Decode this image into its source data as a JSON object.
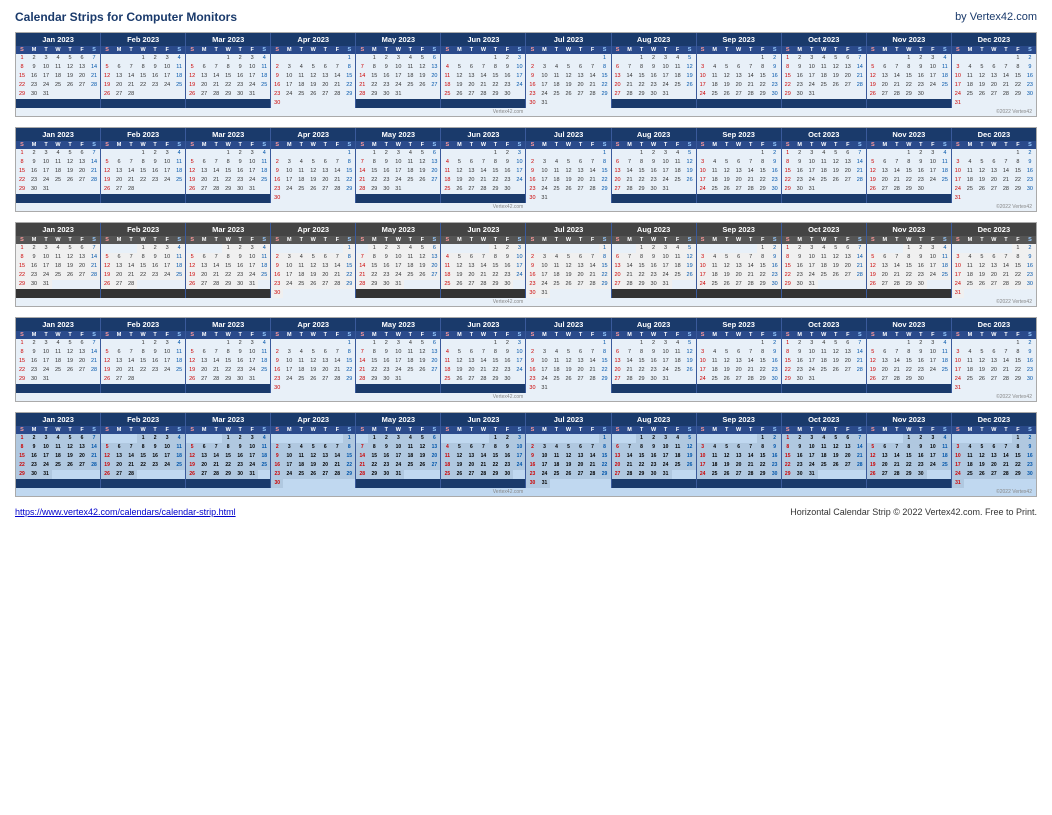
{
  "header": {
    "title": "Calendar Strips for Computer Monitors",
    "brand": "by Vertex42.com"
  },
  "footer": {
    "url": "https://www.vertex42.com/calendars/calendar-strip.html",
    "copyright": "Horizontal Calendar Strip © 2022 Vertex42.com. Free to Print."
  },
  "year": "2023",
  "months": [
    {
      "name": "Jan 2023",
      "startDay": 0,
      "days": 31
    },
    {
      "name": "Feb 2023",
      "startDay": 3,
      "days": 28
    },
    {
      "name": "Mar 2023",
      "startDay": 3,
      "days": 31
    },
    {
      "name": "Apr 2023",
      "startDay": 6,
      "days": 30
    },
    {
      "name": "May 2023",
      "startDay": 1,
      "days": 31
    },
    {
      "name": "Jun 2023",
      "startDay": 4,
      "days": 30
    },
    {
      "name": "Jul 2023",
      "startDay": 6,
      "days": 31
    },
    {
      "name": "Aug 2023",
      "startDay": 2,
      "days": 31
    },
    {
      "name": "Sep 2023",
      "startDay": 5,
      "days": 30
    },
    {
      "name": "Oct 2023",
      "startDay": 0,
      "days": 31
    },
    {
      "name": "Nov 2023",
      "startDay": 3,
      "days": 30
    },
    {
      "name": "Dec 2023",
      "startDay": 5,
      "days": 31
    }
  ],
  "dayHeaders": [
    "S",
    "M",
    "T",
    "W",
    "T",
    "F",
    "S"
  ],
  "watermark": "Vertex42.com",
  "stripCopyright": "©2022 Vertex42"
}
